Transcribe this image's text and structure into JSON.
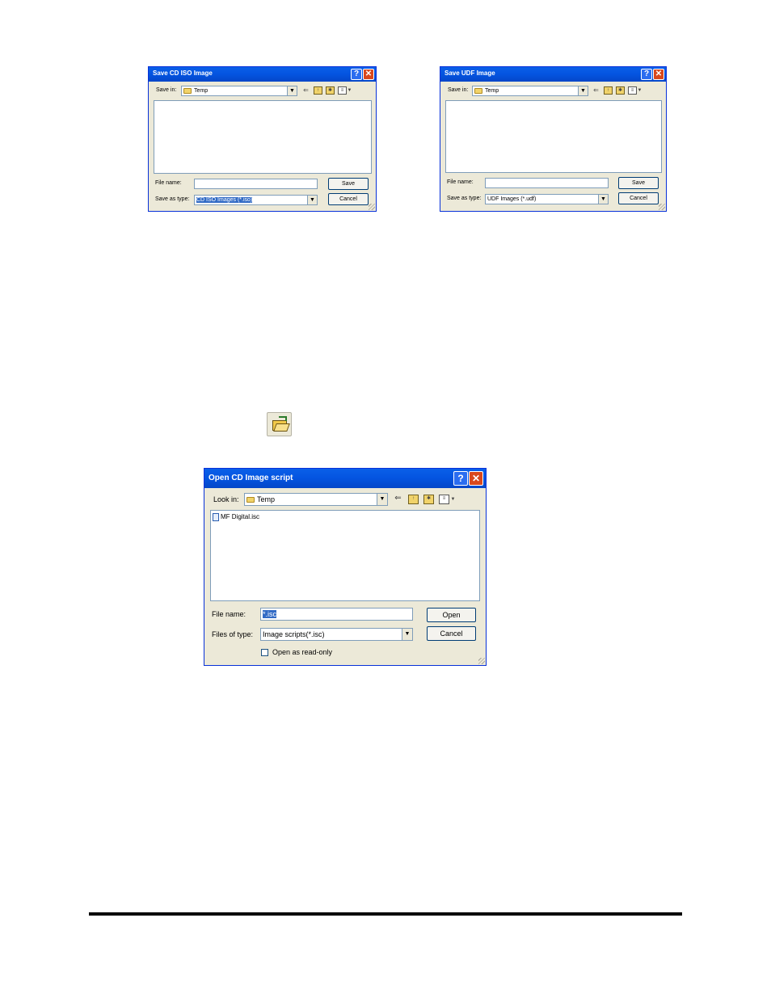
{
  "iso_dialog": {
    "title": "Save CD ISO Image",
    "save_in_label": "Save in:",
    "location": "Temp",
    "file_name_label": "File name:",
    "file_name_value": "",
    "save_as_type_label": "Save as type:",
    "save_as_type_value": "CD ISO Images (*.iso)",
    "save_button": "Save",
    "cancel_button": "Cancel"
  },
  "udf_dialog": {
    "title": "Save UDF Image",
    "save_in_label": "Save in:",
    "location": "Temp",
    "file_name_label": "File name:",
    "file_name_value": "",
    "save_as_type_label": "Save as type:",
    "save_as_type_value": "UDF Images (*.udf)",
    "save_button": "Save",
    "cancel_button": "Cancel"
  },
  "open_dialog": {
    "title": "Open CD Image script",
    "look_in_label": "Look in:",
    "location": "Temp",
    "files": [
      "MF Digital.isc"
    ],
    "file_name_label": "File name:",
    "file_name_value": "*.isc",
    "files_of_type_label": "Files of type:",
    "files_of_type_value": "Image scripts(*.isc)",
    "open_button": "Open",
    "cancel_button": "Cancel",
    "read_only_label": "Open as read-only",
    "read_only_checked": false
  },
  "icons": {
    "toolbar_open": "open-folder-icon",
    "back": "back-arrow-icon",
    "up": "up-folder-icon",
    "new_folder": "new-folder-icon",
    "views": "views-menu-icon"
  },
  "colors": {
    "titlebar": "#0454e0",
    "close_button": "#d9481c",
    "dialog_face": "#ece9d8",
    "selection": "#316ac5"
  }
}
